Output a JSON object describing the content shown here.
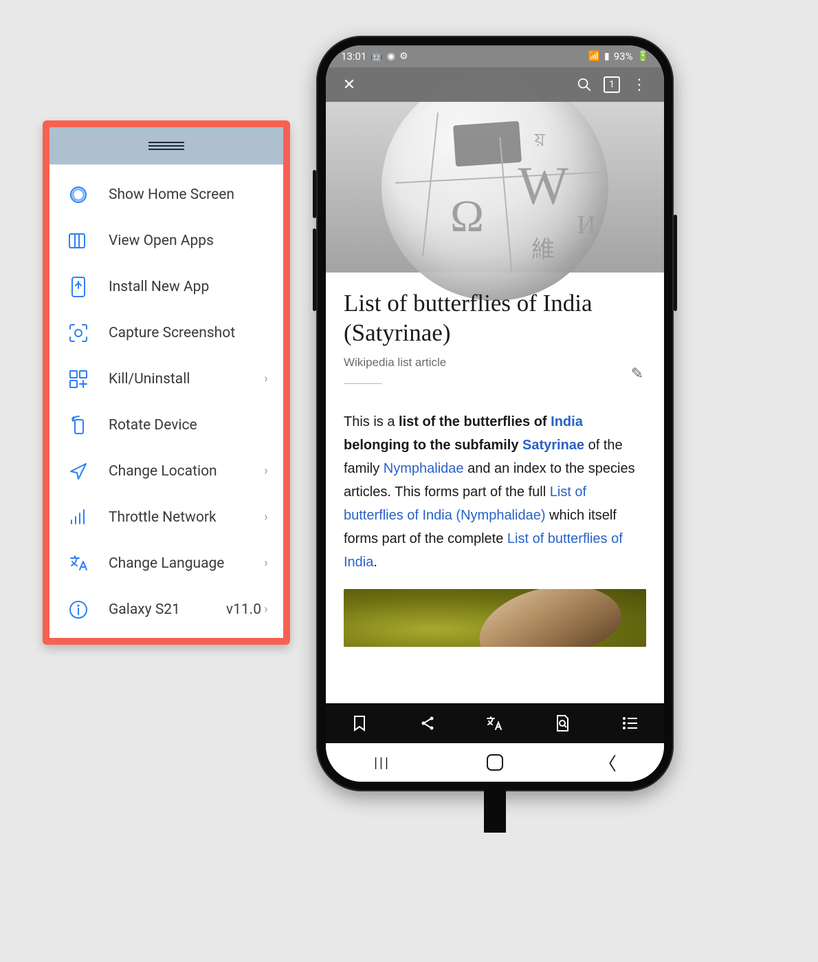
{
  "panel": {
    "items": [
      {
        "label": "Show Home Screen",
        "icon": "circle-home-icon",
        "chevron": false
      },
      {
        "label": "View Open Apps",
        "icon": "recent-apps-icon",
        "chevron": false
      },
      {
        "label": "Install New App",
        "icon": "install-app-icon",
        "chevron": false
      },
      {
        "label": "Capture Screenshot",
        "icon": "capture-icon",
        "chevron": false
      },
      {
        "label": "Kill/Uninstall",
        "icon": "apps-grid-icon",
        "chevron": true
      },
      {
        "label": "Rotate Device",
        "icon": "rotate-icon",
        "chevron": false
      },
      {
        "label": "Change Location",
        "icon": "location-icon",
        "chevron": true
      },
      {
        "label": "Throttle Network",
        "icon": "network-bars-icon",
        "chevron": true
      },
      {
        "label": "Change Language",
        "icon": "translate-icon",
        "chevron": true
      }
    ],
    "device_row": {
      "label": "Galaxy S21",
      "version": "v11.0",
      "icon": "info-icon",
      "chevron": true
    }
  },
  "phone": {
    "status": {
      "time": "13:01",
      "battery": "93%"
    },
    "browser": {
      "tab_count": "1"
    },
    "article": {
      "title": "List of butterflies of India (Satyrinae)",
      "subtitle": "Wikipedia list article",
      "p_this_is_a": "This is a ",
      "p_list_bold": "list of the butterflies of ",
      "link_india": "India",
      "p_belonging": " belonging to the subfamily ",
      "link_satyrinae": "Satyrinae",
      "p_of_family": " of the family ",
      "link_nymphalidae": "Nymphalidae",
      "p_index": " and an index to the species articles. This forms part of the full ",
      "link_list_nymph": "List of butterflies of India (Nymphalidae)",
      "p_which": " which itself forms part of the complete ",
      "link_list_india": "List of butterflies of India",
      "p_period": "."
    }
  }
}
